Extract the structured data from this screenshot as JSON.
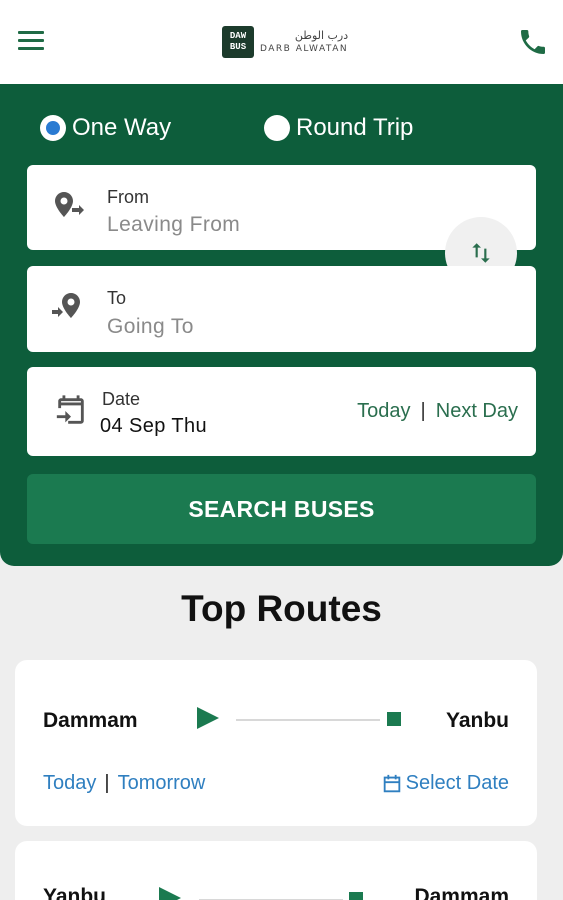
{
  "header": {
    "logo_mark": "DAW BUS",
    "logo_arabic": "درب الوطن",
    "logo_english": "DARB ALWATAN"
  },
  "trip_type": {
    "one_way": "One Way",
    "round_trip": "Round Trip",
    "selected": "One Way"
  },
  "from": {
    "label": "From",
    "placeholder": "Leaving From"
  },
  "to": {
    "label": "To",
    "placeholder": "Going To"
  },
  "date": {
    "label": "Date",
    "value": "04 Sep Thu",
    "today": "Today",
    "separator": "|",
    "next_day": "Next Day"
  },
  "search_button": "SEARCH BUSES",
  "top_routes": {
    "title": "Top Routes",
    "routes": [
      {
        "origin": "Dammam",
        "destination": "Yanbu",
        "today": "Today",
        "separator": "|",
        "tomorrow": "Tomorrow",
        "select_date": "Select Date"
      },
      {
        "origin": "Yanbu",
        "destination": "Dammam"
      }
    ]
  },
  "colors": {
    "brand_green": "#0d5d3b",
    "button_green": "#1b7a50",
    "link_blue": "#2f7fc0",
    "radio_blue": "#2a7bd2"
  }
}
